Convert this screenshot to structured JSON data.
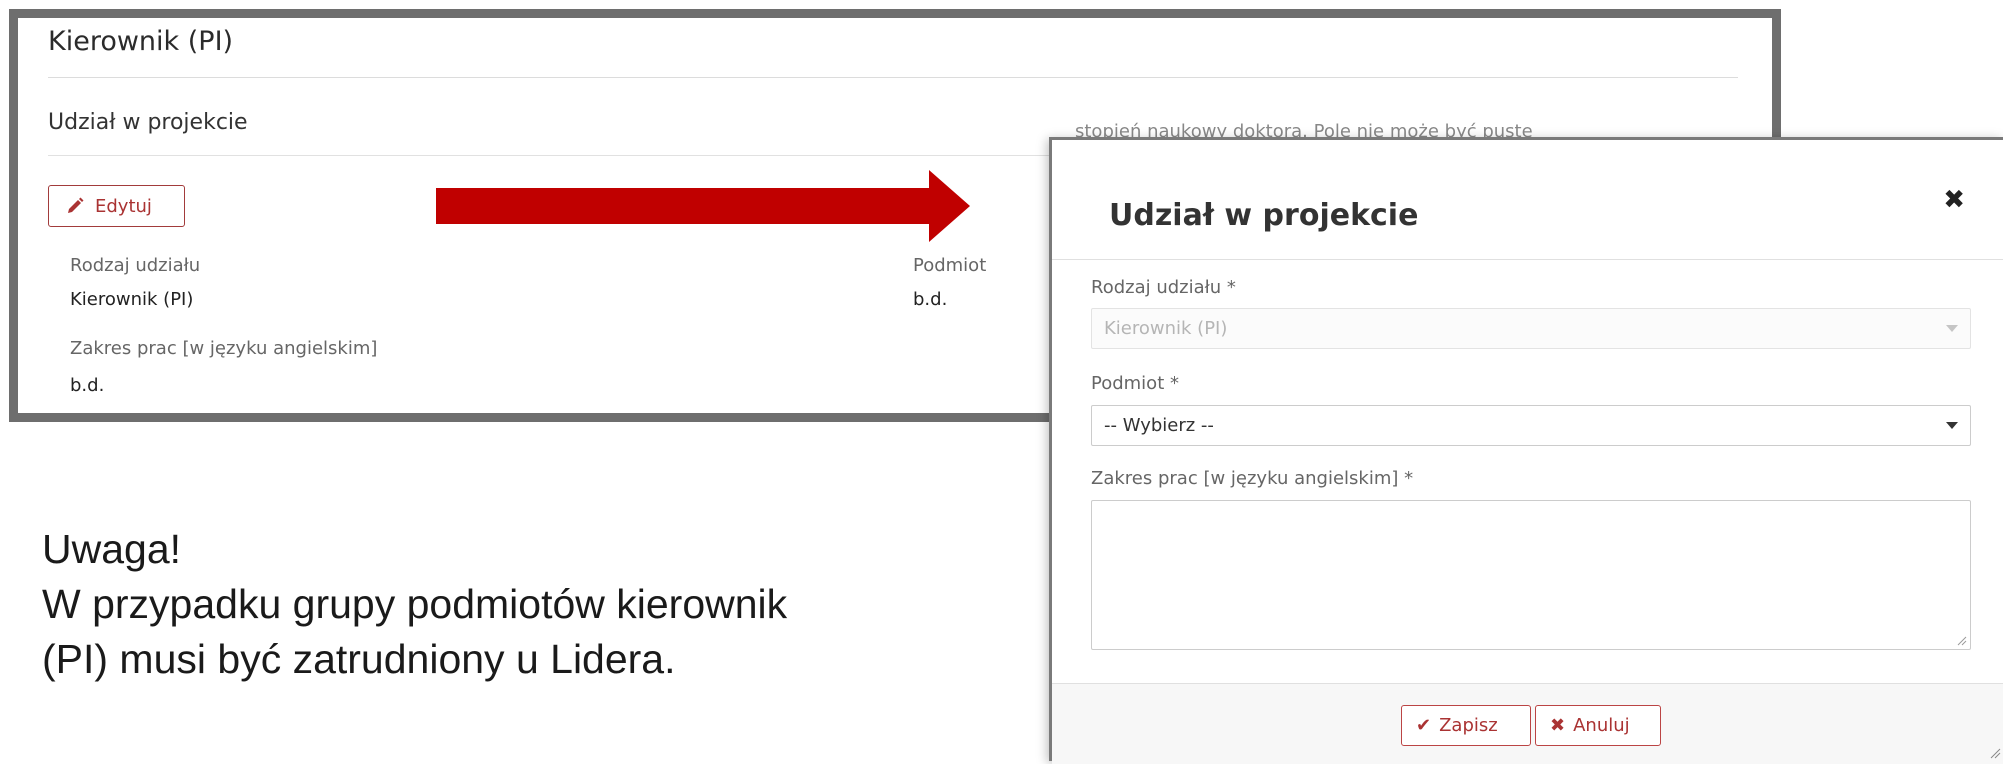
{
  "panel": {
    "title": "Kierownik (PI)",
    "section_title": "Udział w projekcie",
    "edit_label": "Edytuj",
    "fields": {
      "rodzaj_label": "Rodzaj udziału",
      "rodzaj_value": "Kierownik (PI)",
      "zakres_label": "Zakres prac [w języku angielskim]",
      "zakres_value": "b.d.",
      "podmiot_label": "Podmiot",
      "podmiot_value": "b.d."
    },
    "partially_hidden_text": "stopień naukowy doktora.   Pole nie może być puste"
  },
  "note": {
    "line1": "Uwaga!",
    "line2": "W przypadku grupy podmiotów kierownik",
    "line3": "(PI) musi być zatrudniony u Lidera."
  },
  "modal": {
    "title": "Udział w projekcie",
    "close_symbol": "✖",
    "rodzaj_label": "Rodzaj udziału *",
    "rodzaj_value": "Kierownik (PI)",
    "podmiot_label": "Podmiot *",
    "podmiot_value": "-- Wybierz --",
    "zakres_label": "Zakres prac [w języku angielskim] *",
    "zakres_value": "",
    "save_label": "Zapisz",
    "cancel_label": "Anuluj"
  },
  "colors": {
    "arrow": "#c00000",
    "frame": "#6e6e6e",
    "button_accent": "#a33333"
  },
  "icons": [
    "pencil-icon",
    "close-icon",
    "check-icon",
    "times-icon",
    "chevron-down-icon",
    "resize-grip-icon"
  ]
}
